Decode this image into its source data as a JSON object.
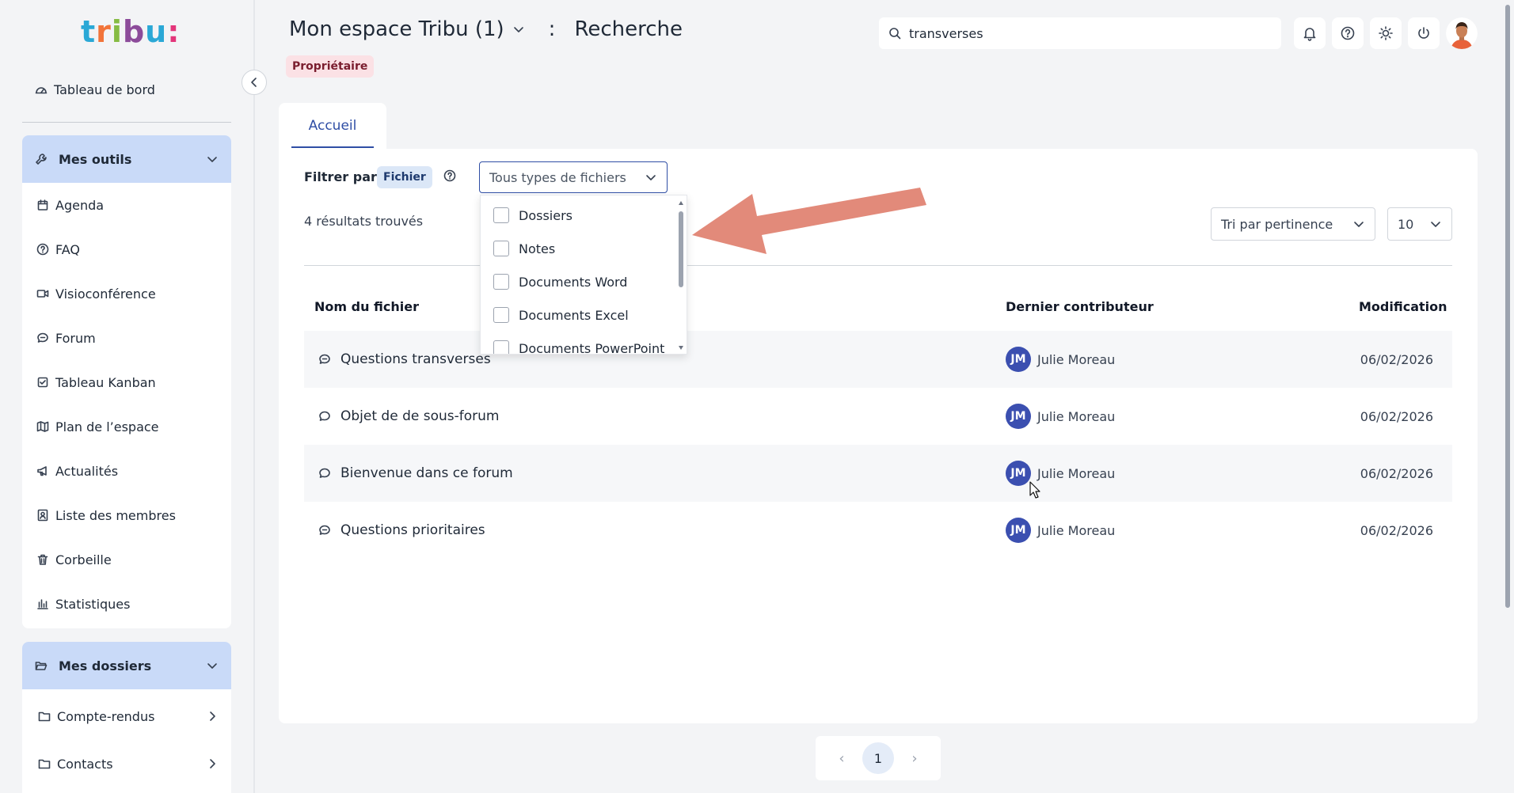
{
  "app": {
    "logo": "tribu:",
    "colors": {
      "accent": "#2f4ea5",
      "sidebar_head": "#c9daf8",
      "owner_badge": "#fbe1e5",
      "avatar": "#3b4fb0",
      "arrow": "#e28a7a"
    }
  },
  "sidebar": {
    "dashboard": "Tableau de bord",
    "tools": {
      "title": "Mes outils",
      "items": [
        {
          "label": "Agenda",
          "icon": "calendar-icon"
        },
        {
          "label": "FAQ",
          "icon": "question-circle-icon"
        },
        {
          "label": "Visioconférence",
          "icon": "video-icon"
        },
        {
          "label": "Forum",
          "icon": "forum-icon"
        },
        {
          "label": "Tableau Kanban",
          "icon": "checkbox-icon"
        },
        {
          "label": "Plan de l’espace",
          "icon": "map-icon"
        },
        {
          "label": "Actualités",
          "icon": "megaphone-icon"
        },
        {
          "label": "Liste des membres",
          "icon": "contacts-icon"
        },
        {
          "label": "Corbeille",
          "icon": "trash-icon"
        },
        {
          "label": "Statistiques",
          "icon": "bar-chart-icon"
        }
      ]
    },
    "folders": {
      "title": "Mes dossiers",
      "items": [
        {
          "label": "Compte-rendus"
        },
        {
          "label": "Contacts"
        }
      ]
    }
  },
  "header": {
    "space": "Mon espace Tribu (1)",
    "separator": ":",
    "page": "Recherche",
    "role": "Propriétaire",
    "search_value": "transverses"
  },
  "tabs": [
    {
      "label": "Accueil",
      "active": true
    }
  ],
  "filter": {
    "label": "Filtrer par:",
    "chip": "Fichier",
    "select_placeholder": "Tous types de fichiers",
    "options": [
      "Dossiers",
      "Notes",
      "Documents Word",
      "Documents Excel",
      "Documents PowerPoint"
    ]
  },
  "results": {
    "count_text": "4 résultats trouvés",
    "sort": "Tri par pertinence",
    "page_size": "10"
  },
  "table": {
    "headers": {
      "name": "Nom du fichier",
      "contributor": "Dernier contributeur",
      "modified": "Modification"
    },
    "rows": [
      {
        "name": "Questions transverses",
        "icon": "forum-icon",
        "initials": "JM",
        "contributor": "Julie Moreau",
        "date": "06/02/2026"
      },
      {
        "name": "Objet de de sous-forum",
        "icon": "chat-icon",
        "initials": "JM",
        "contributor": "Julie Moreau",
        "date": "06/02/2026"
      },
      {
        "name": "Bienvenue dans ce forum",
        "icon": "chat-icon",
        "initials": "JM",
        "contributor": "Julie Moreau",
        "date": "06/02/2026"
      },
      {
        "name": "Questions prioritaires",
        "icon": "forum-icon",
        "initials": "JM",
        "contributor": "Julie Moreau",
        "date": "06/02/2026"
      }
    ]
  },
  "pagination": {
    "current": "1",
    "prev": "‹",
    "next": "›"
  }
}
